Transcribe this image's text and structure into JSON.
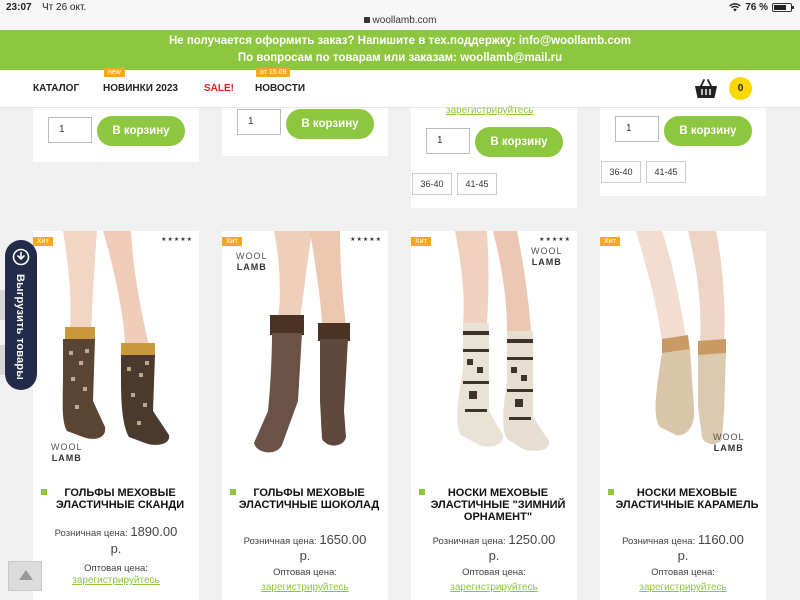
{
  "status_bar": {
    "time": "23:07",
    "date": "Чт 26 окт.",
    "url": "woollamb.com",
    "battery": "76 %",
    "battery_level": 0.76
  },
  "banner": {
    "line1": "Не получается оформить заказ? Напишите в тех.поддержку: info@woollamb.com",
    "line2": "По вопросам по товарам или заказам: woollamb@mail.ru",
    "color": "#8dc63f"
  },
  "nav": {
    "items": [
      {
        "label": "КАТАЛОГ",
        "badge": ""
      },
      {
        "label": "НОВИНКИ 2023",
        "badge": "new"
      },
      {
        "label": "SALE!",
        "badge": ""
      },
      {
        "label": "НОВОСТИ",
        "badge": "от 15.09"
      }
    ],
    "cart_count": "0",
    "cart_icon": "basket-icon"
  },
  "top_cards": {
    "qty_value": "1",
    "cart_label": "В корзину",
    "register_link": "зарегистрируйтесь",
    "sizes": [
      "36-40",
      "41-45"
    ]
  },
  "products": [
    {
      "badge": "Хит",
      "title": "ГОЛЬФЫ МЕХОВЫЕ ЭЛАСТИЧНЫЕ СКАНДИ",
      "retail_label": "Розничная цена:",
      "retail_value": "1890.00",
      "currency": "р.",
      "wholesale_label": "Оптовая цена:",
      "register_link": "зарегистрируйтесь",
      "logo_top": "WOOL",
      "logo_bottom": "LAMB"
    },
    {
      "badge": "Хит",
      "title": "ГОЛЬФЫ МЕХОВЫЕ ЭЛАСТИЧНЫЕ ШОКОЛАД",
      "retail_label": "Розничная цена:",
      "retail_value": "1650.00",
      "currency": "р.",
      "wholesale_label": "Оптовая цена:",
      "register_link": "зарегистрируйтесь",
      "logo_top": "WOOL",
      "logo_bottom": "LAMB"
    },
    {
      "badge": "Хит",
      "title": "НОСКИ МЕХОВЫЕ ЭЛАСТИЧНЫЕ \"ЗИМНИЙ ОРНАМЕНТ\"",
      "retail_label": "Розничная цена:",
      "retail_value": "1250.00",
      "currency": "р.",
      "wholesale_label": "Оптовая цена:",
      "register_link": "зарегистрируйтесь",
      "logo_top": "WOOL",
      "logo_bottom": "LAMB"
    },
    {
      "badge": "Хит",
      "title": "НОСКИ МЕХОВЫЕ ЭЛАСТИЧНЫЕ КАРАМЕЛЬ",
      "retail_label": "Розничная цена:",
      "retail_value": "1160.00",
      "currency": "р.",
      "wholesale_label": "Оптовая цена:",
      "register_link": "зарегистрируйтесь",
      "logo_top": "WOOL",
      "logo_bottom": "LAMB"
    }
  ],
  "stars": "★★★★★",
  "side_widget": {
    "label": "Выгрузить товары",
    "icon": "export-icon"
  },
  "to_top_icon": "arrow-up-icon"
}
